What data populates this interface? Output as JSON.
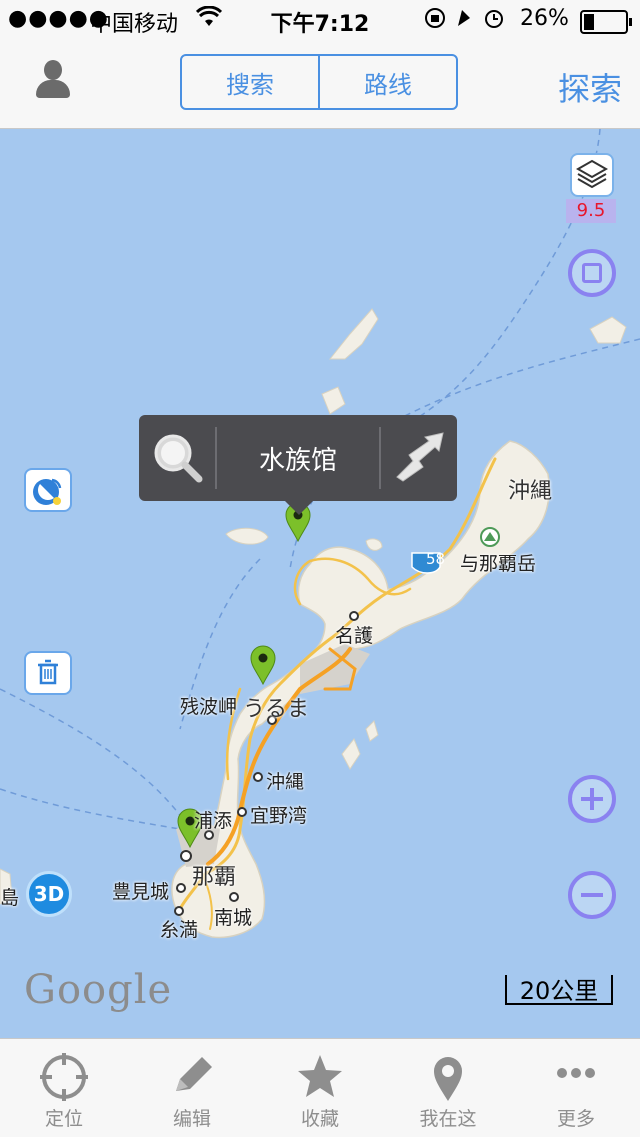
{
  "status_bar": {
    "signal": "●●●●●",
    "carrier": "中国移动",
    "time": "下午7:12",
    "battery_percent": "26%",
    "battery_level": 0.26
  },
  "nav": {
    "avatar_icon": "person-icon",
    "segments": [
      "搜索",
      "路线"
    ],
    "right_button": "探索",
    "accent_color": "#4a90e2"
  },
  "map": {
    "zoom_level": "9.5",
    "callout": {
      "title": "水族馆",
      "left_icon": "magnifier-icon",
      "right_icon": "route-arrow-icon"
    },
    "labels": {
      "okinawa": "沖縄",
      "yonaha": "与那覇岳",
      "nago": "名護",
      "zanpa": "残波岬",
      "uruma": "うるま",
      "okinawa_city": "沖縄",
      "urasoe": "浦添",
      "ginowan": "宜野湾",
      "naha": "那覇",
      "tomigusuku": "豊見城",
      "itoman": "糸満",
      "nanjo": "南城",
      "edge_island": "島",
      "route_shield": "58"
    },
    "buttons": {
      "three_d": "3D"
    },
    "attribution": "Google",
    "scale": "20公里",
    "pin_color": "#7cc02a",
    "water_color": "#a5c8ef"
  },
  "tabbar": {
    "items": [
      {
        "label": "定位",
        "icon": "crosshair-icon"
      },
      {
        "label": "编辑",
        "icon": "pencil-icon"
      },
      {
        "label": "收藏",
        "icon": "star-icon"
      },
      {
        "label": "我在这",
        "icon": "location-pin-icon"
      },
      {
        "label": "更多",
        "icon": "more-dots-icon"
      }
    ]
  }
}
